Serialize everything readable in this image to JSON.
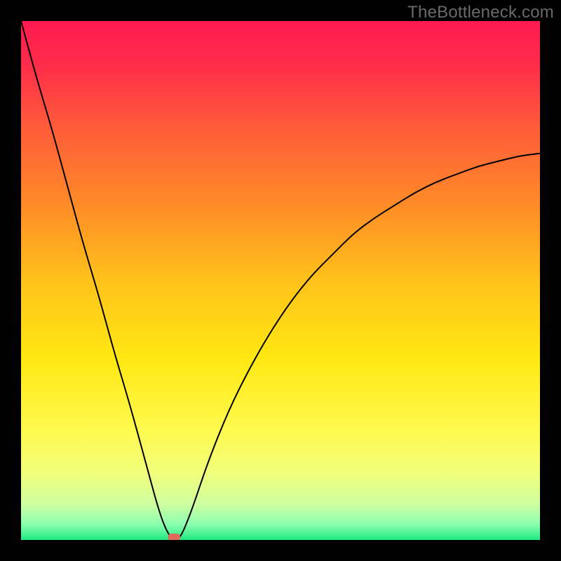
{
  "watermark": "TheBottleneck.com",
  "chart_data": {
    "type": "line",
    "title": "",
    "xlabel": "",
    "ylabel": "",
    "xlim": [
      0,
      100
    ],
    "ylim": [
      0,
      100
    ],
    "x": [
      0,
      3,
      6,
      9,
      12,
      15,
      18,
      21,
      24,
      27,
      29,
      30,
      31,
      33,
      36,
      40,
      44,
      48,
      52,
      56,
      60,
      64,
      68,
      72,
      76,
      80,
      84,
      88,
      92,
      96,
      100
    ],
    "y": [
      100,
      89,
      79,
      68,
      57,
      47,
      36,
      26,
      15,
      4,
      0,
      0,
      1,
      6,
      15,
      25,
      33,
      40,
      46,
      51,
      55,
      59,
      62,
      64.5,
      67,
      69,
      70.5,
      72,
      73,
      74,
      74.5
    ],
    "minimum_x": 29.5,
    "minimum_marker": true,
    "background": {
      "type": "vertical_gradient",
      "stops": [
        {
          "pos": 0.0,
          "color": "#ff1a4f"
        },
        {
          "pos": 0.08,
          "color": "#ff2b4a"
        },
        {
          "pos": 0.2,
          "color": "#ff5a3a"
        },
        {
          "pos": 0.35,
          "color": "#ff8a28"
        },
        {
          "pos": 0.5,
          "color": "#ffc21a"
        },
        {
          "pos": 0.65,
          "color": "#ffe812"
        },
        {
          "pos": 0.78,
          "color": "#fff94a"
        },
        {
          "pos": 0.87,
          "color": "#f1ff7a"
        },
        {
          "pos": 0.93,
          "color": "#cfffa0"
        },
        {
          "pos": 0.97,
          "color": "#8bffb0"
        },
        {
          "pos": 1.0,
          "color": "#20e880"
        }
      ]
    }
  }
}
